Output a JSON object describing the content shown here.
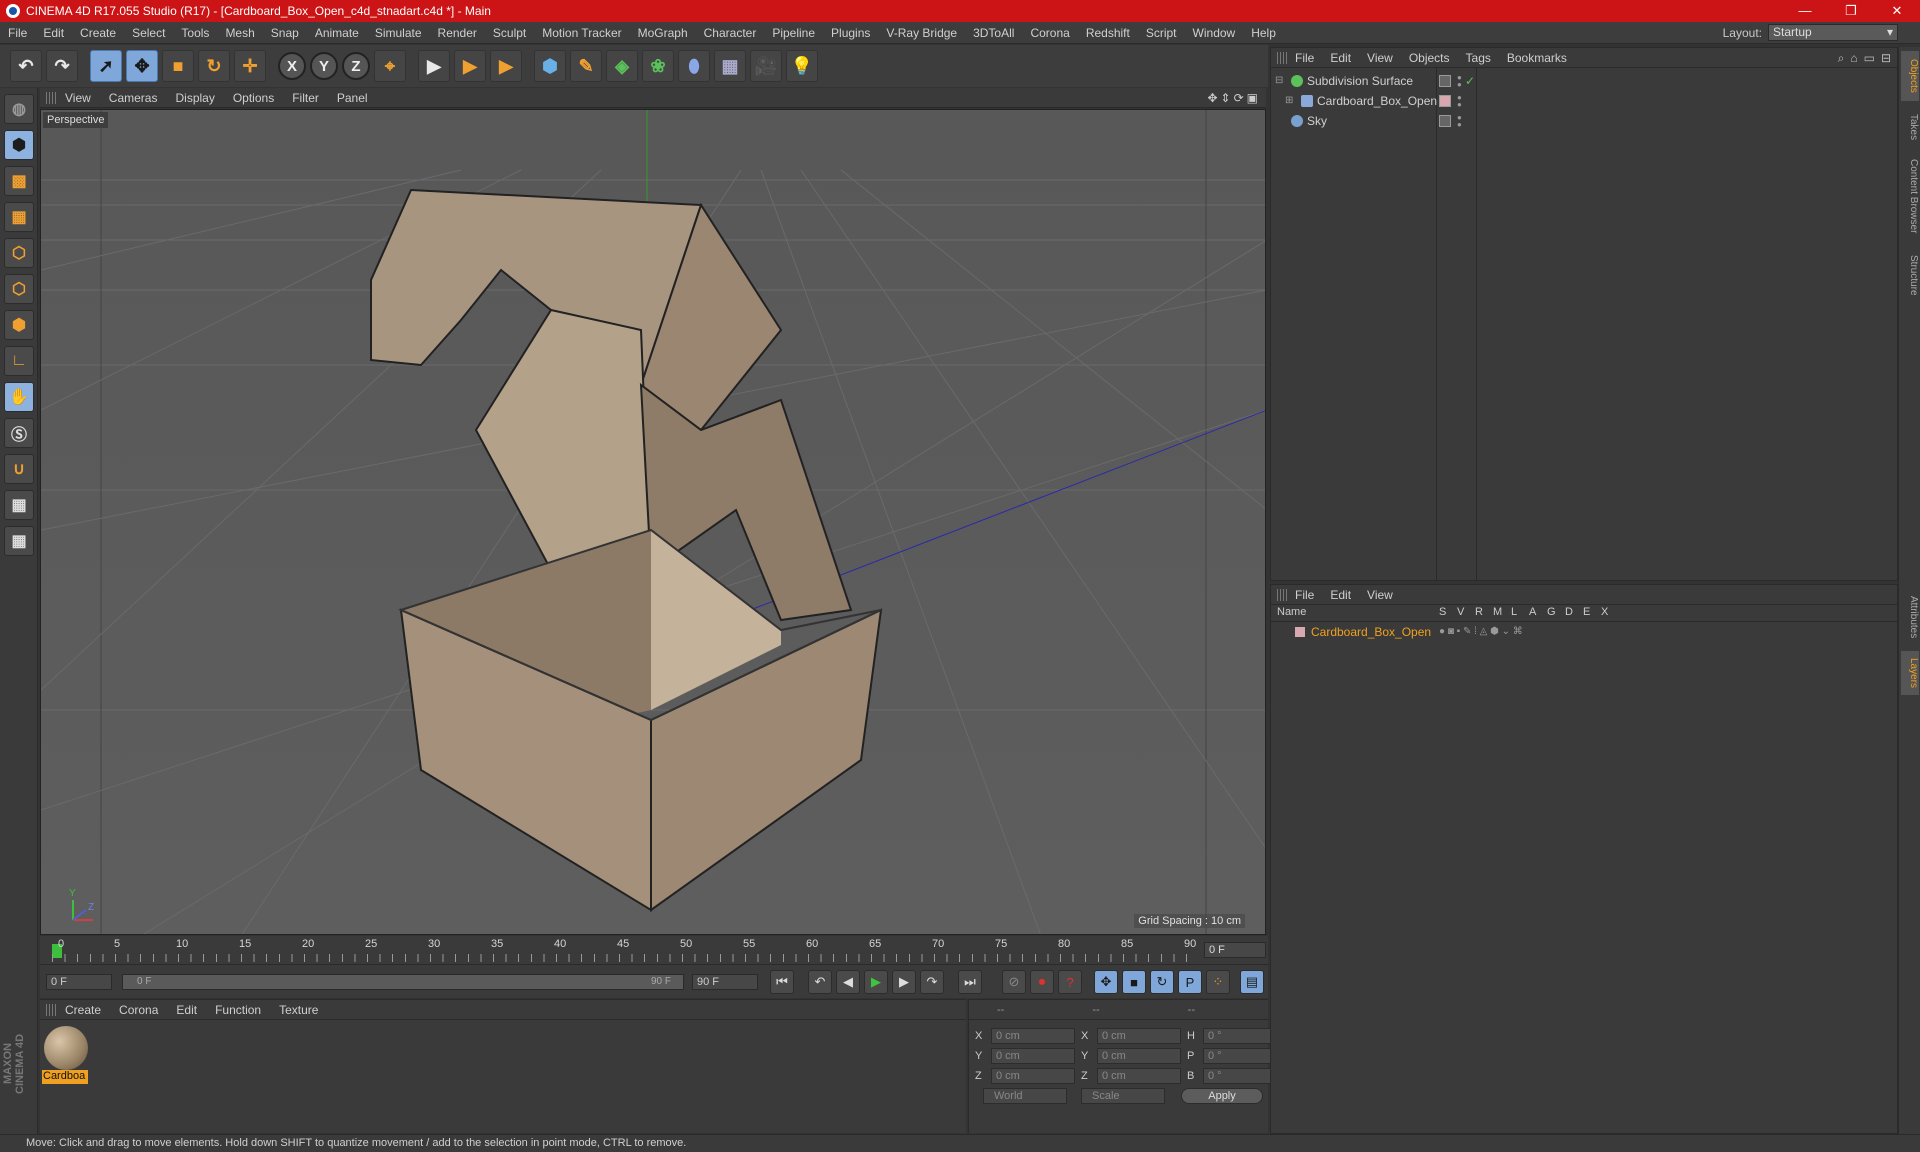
{
  "window": {
    "title": "CINEMA 4D R17.055 Studio (R17) - [Cardboard_Box_Open_c4d_stnadart.c4d *] - Main",
    "minimize": "—",
    "restore": "❐",
    "close": "✕"
  },
  "menu": [
    "File",
    "Edit",
    "Create",
    "Select",
    "Tools",
    "Mesh",
    "Snap",
    "Animate",
    "Simulate",
    "Render",
    "Sculpt",
    "Motion Tracker",
    "MoGraph",
    "Character",
    "Pipeline",
    "Plugins",
    "V-Ray Bridge",
    "3DToAll",
    "Corona",
    "Redshift",
    "Script",
    "Window",
    "Help"
  ],
  "layout": {
    "label": "Layout:",
    "value": "Startup"
  },
  "toolbar": {
    "undo": "↶",
    "redo": "↷",
    "select": "➚",
    "move": "✥",
    "scale": "■",
    "rotate": "↻",
    "multi": "✛",
    "x": "X",
    "y": "Y",
    "z": "Z",
    "coord": "⌖",
    "render1": "▶",
    "render2": "▶",
    "render3": "▶",
    "cube": "⬢",
    "pen": "✎",
    "subdiv": "◈",
    "cloner": "❀",
    "deformer": "⬮",
    "floor": "▦",
    "camera": "🎥",
    "light": "💡"
  },
  "viewport": {
    "menu": [
      "View",
      "Cameras",
      "Display",
      "Options",
      "Filter",
      "Panel"
    ],
    "label": "Perspective",
    "grid_spacing": "Grid Spacing : 10 cm",
    "axis": {
      "y": "Y",
      "z": "Z"
    }
  },
  "timeline": {
    "ticks": [
      "0",
      "5",
      "10",
      "15",
      "20",
      "25",
      "30",
      "35",
      "40",
      "45",
      "50",
      "55",
      "60",
      "65",
      "70",
      "75",
      "80",
      "85",
      "90"
    ],
    "current_frame": "0 F",
    "start": "0 F",
    "slider_start": "0 F",
    "slider_end": "90 F",
    "end": "90 F"
  },
  "material_panel": {
    "menu": [
      "Create",
      "Corona",
      "Edit",
      "Function",
      "Texture"
    ],
    "material_name": "Cardboa"
  },
  "coords": {
    "headers": [
      "--",
      "--",
      "--"
    ],
    "rows": [
      {
        "a": "X",
        "av": "0 cm",
        "b": "X",
        "bv": "0 cm",
        "c": "H",
        "cv": "0 °"
      },
      {
        "a": "Y",
        "av": "0 cm",
        "b": "Y",
        "bv": "0 cm",
        "c": "P",
        "cv": "0 °"
      },
      {
        "a": "Z",
        "av": "0 cm",
        "b": "Z",
        "bv": "0 cm",
        "c": "B",
        "cv": "0 °"
      }
    ],
    "mode1": "World",
    "mode2": "Scale",
    "apply": "Apply"
  },
  "objects_panel": {
    "menu": [
      "File",
      "Edit",
      "View",
      "Objects",
      "Tags",
      "Bookmarks"
    ],
    "items": [
      {
        "name": "Subdivision Surface",
        "color": "#5bc25b"
      },
      {
        "name": "Cardboard_Box_Open",
        "color": "#8aa8d8"
      },
      {
        "name": "Sky",
        "color": "#7aa0d0"
      }
    ]
  },
  "layers_panel": {
    "menu": [
      "File",
      "Edit",
      "View"
    ],
    "columns": {
      "name": "Name",
      "flags": [
        "S",
        "V",
        "R",
        "M",
        "L",
        "A",
        "G",
        "D",
        "E",
        "X"
      ]
    },
    "rows": [
      {
        "name": "Cardboard_Box_Open",
        "color": "#f0a020"
      }
    ]
  },
  "right_tabs": [
    "Objects",
    "Takes",
    "Content Browser",
    "Structure",
    "Attributes",
    "Layers"
  ],
  "maxon": "MAXON CINEMA 4D",
  "status": "Move: Click and drag to move elements. Hold down SHIFT to quantize movement / add to the selection in point mode, CTRL to remove."
}
